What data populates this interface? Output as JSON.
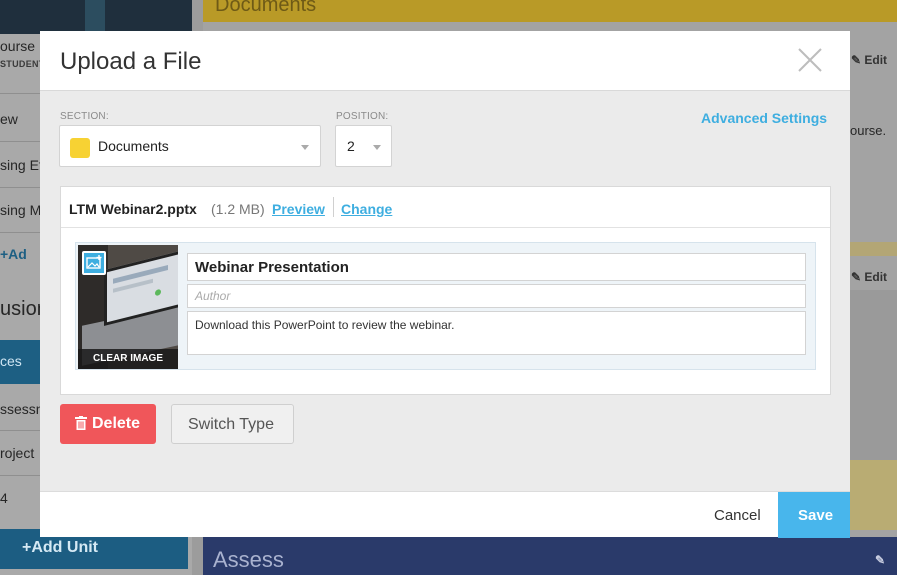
{
  "background": {
    "left_items": [
      "ourse",
      "STUDENT",
      "ew",
      "sing Ef",
      "sing M",
      "+Ad",
      "usion",
      "ces",
      "ssessn",
      "roject",
      "4"
    ],
    "add_unit_label": "+Add Unit",
    "top_section_label": "Documents",
    "edit_label": "Edit",
    "right_snippet": "ourse.",
    "bottom_section_label": "Assess"
  },
  "modal": {
    "title": "Upload a File",
    "section": {
      "label": "SECTION:",
      "value": "Documents",
      "swatch_color": "#f7d233"
    },
    "position": {
      "label": "POSITION:",
      "value": "2"
    },
    "advanced_settings_label": "Advanced Settings",
    "file": {
      "name": "LTM Webinar2.pptx",
      "size": "(1.2 MB)",
      "preview_label": "Preview",
      "change_label": "Change"
    },
    "item": {
      "clear_image_label": "CLEAR IMAGE",
      "title_value": "Webinar Presentation",
      "author_placeholder": "Author",
      "description_value": "Download this PowerPoint to review the webinar."
    },
    "delete_label": "Delete",
    "switch_type_label": "Switch Type",
    "cancel_label": "Cancel",
    "save_label": "Save"
  },
  "colors": {
    "accent": "#3eaee0",
    "danger": "#f0565a",
    "save": "#48b6ec"
  }
}
